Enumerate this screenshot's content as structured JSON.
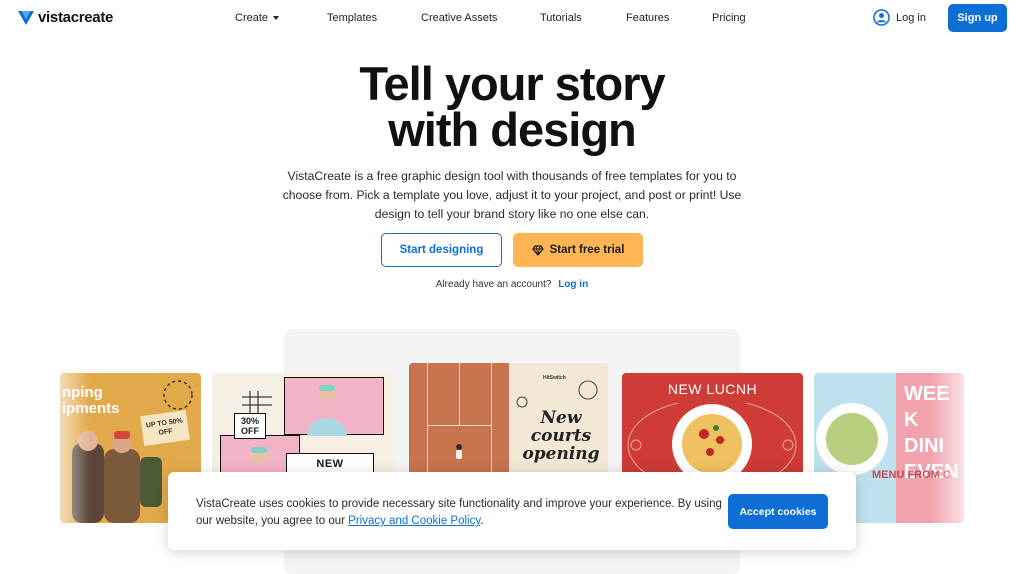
{
  "header": {
    "logo_text": "vistacreate",
    "nav": [
      "Create",
      "Templates",
      "Creative Assets",
      "Tutorials",
      "Features",
      "Pricing"
    ],
    "login_label": "Log in",
    "signup_label": "Sign up"
  },
  "hero": {
    "title_line1": "Tell your story",
    "title_line2": "with design",
    "subtitle": "VistaCreate is a free graphic design tool with thousands of free templates for you to choose from. Pick a template you love, adjust it to your project, and post or print! Use design to tell your brand story like no one else can.",
    "start_designing_label": "Start designing",
    "start_trial_label": "Start free trial",
    "account_prompt": "Already have an account?",
    "account_login_label": "Log in"
  },
  "gallery": {
    "card1": {
      "text_line1": "nping",
      "text_line2": "ipments",
      "tag": "UP TO 50% OFF"
    },
    "card2": {
      "off": "30% OFF",
      "new": "NEW"
    },
    "card3": {
      "brand": "HitSwitch",
      "title": "New courts opening"
    },
    "card4": {
      "title": "NEW LUCNH"
    },
    "card5": {
      "big_text": "WEEK DINI EVEN",
      "menu_text": "MENU FROM C"
    }
  },
  "cookie": {
    "text": "VistaCreate uses cookies to provide necessary site functionality and improve your experience. By using our website, you agree to our ",
    "link_label": "Privacy and Cookie Policy",
    "text_end": ".",
    "accept_label": "Accept cookies"
  },
  "colors": {
    "brand_blue": "#0d6fd6",
    "trial_orange": "#ffb553"
  },
  "icons": {
    "logo": "vistacreate-logo-icon",
    "caret": "chevron-down-icon",
    "user": "user-circle-icon",
    "gem": "diamond-icon"
  }
}
